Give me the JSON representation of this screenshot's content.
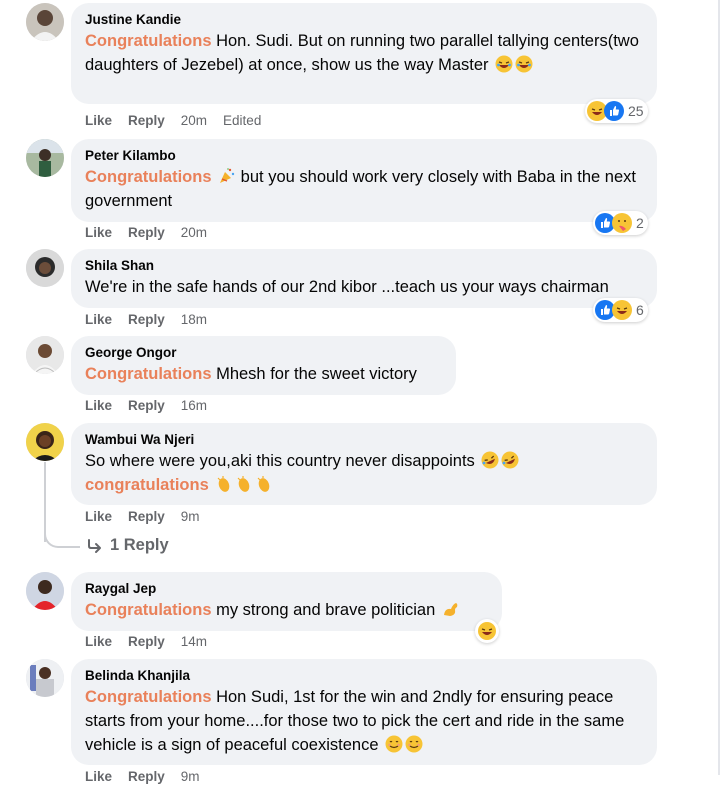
{
  "comments": [
    {
      "author": "Justine Kandie",
      "highlight": "Congratulations",
      "text": " Hon. Sudi. But on running two parallel tallying centers(two daughters of Jezebel) at once, show us the way Master ",
      "actions": {
        "like": "Like",
        "reply": "Reply",
        "time": "20m",
        "edited": "Edited"
      },
      "reactions": {
        "count": "25",
        "icons": [
          "haha",
          "like"
        ]
      }
    },
    {
      "author": "Peter Kilambo",
      "highlight": "Congratulations",
      "text": " but you should work very closely with Baba in the next government",
      "actions": {
        "like": "Like",
        "reply": "Reply",
        "time": "20m"
      },
      "reactions": {
        "count": "2",
        "icons": [
          "like",
          "care"
        ]
      }
    },
    {
      "author": "Shila Shan",
      "text": "We're in the safe hands of our 2nd kibor ...teach us your ways chairman",
      "actions": {
        "like": "Like",
        "reply": "Reply",
        "time": "18m"
      },
      "reactions": {
        "count": "6",
        "icons": [
          "like",
          "haha"
        ]
      }
    },
    {
      "author": "George Ongor",
      "highlight": "Congratulations",
      "text": " Mhesh for the sweet victory",
      "actions": {
        "like": "Like",
        "reply": "Reply",
        "time": "16m"
      }
    },
    {
      "author": "Wambui Wa Njeri",
      "text": "So where were you,aki this country never disappoints ",
      "highlight2": "congratulations",
      "actions": {
        "like": "Like",
        "reply": "Reply",
        "time": "9m"
      },
      "replies": "1 Reply"
    },
    {
      "author": "Raygal Jep",
      "highlight": "Congratulations",
      "text": " my strong and brave politician ",
      "actions": {
        "like": "Like",
        "reply": "Reply",
        "time": "14m"
      }
    },
    {
      "author": "Belinda Khanjila",
      "highlight": "Congratulations",
      "text": " Hon Sudi, 1st for the win and 2ndly for ensuring peace starts from your home....for those two to pick the cert and ride in the same vehicle is a sign of peaceful coexistence ",
      "actions": {
        "like": "Like",
        "reply": "Reply",
        "time": "9m"
      }
    }
  ],
  "colors": {
    "highlight": "#e9815a",
    "bubble": "#f0f2f5",
    "meta": "#65676b",
    "like_blue": "#1877f2"
  }
}
